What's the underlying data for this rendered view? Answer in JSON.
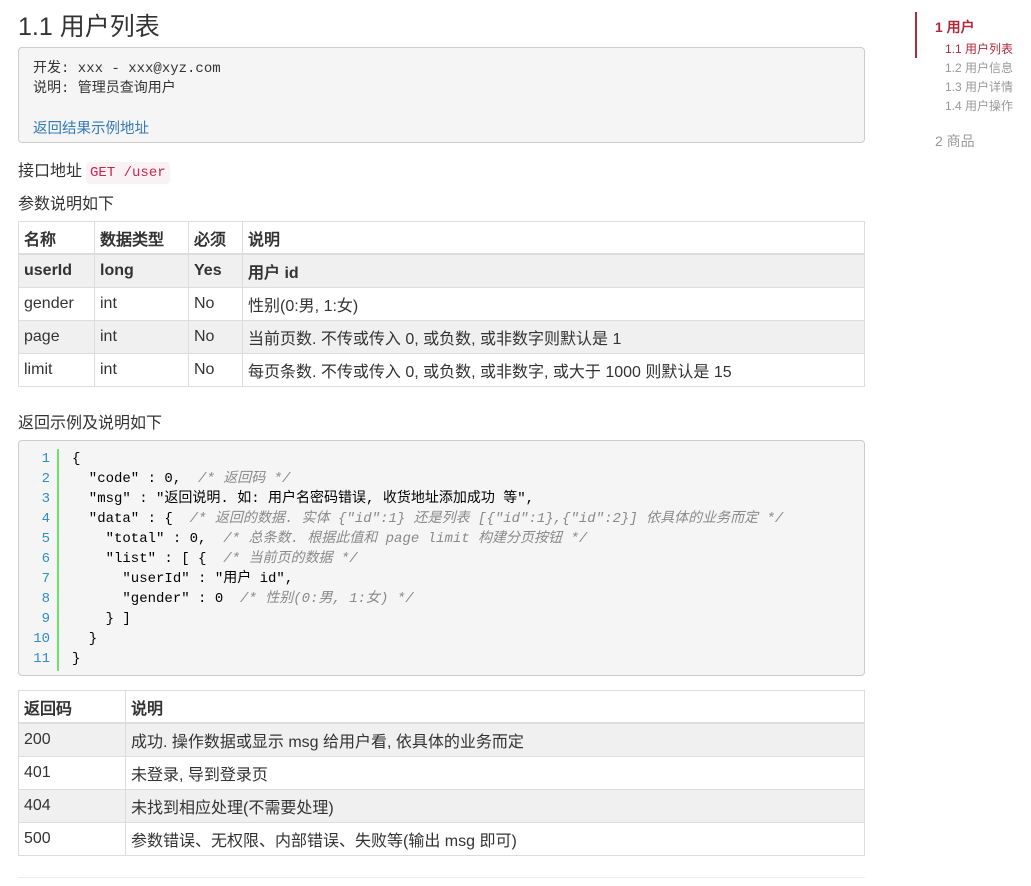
{
  "page": {
    "title": "1.1 用户列表",
    "info": {
      "developer_line": "开发: xxx - xxx@xyz.com",
      "description_line": "说明: 管理员查询用户",
      "example_link": "返回结果示例地址"
    },
    "api": {
      "label": "接口地址",
      "value": "GET /user"
    },
    "params_heading": "参数说明如下",
    "params_table": {
      "headers": [
        "名称",
        "数据类型",
        "必须",
        "说明"
      ],
      "rows": [
        [
          "userId",
          "long",
          "Yes",
          "用户 id"
        ],
        [
          "gender",
          "int",
          "No",
          "性别(0:男, 1:女)"
        ],
        [
          "page",
          "int",
          "No",
          "当前页数. 不传或传入 0, 或负数, 或非数字则默认是 1"
        ],
        [
          "limit",
          "int",
          "No",
          "每页条数. 不传或传入 0, 或负数, 或非数字, 或大于 1000 则默认是 15"
        ]
      ]
    },
    "return_heading": "返回示例及说明如下",
    "code_sample": {
      "line_numbers": [
        "1",
        "2",
        "3",
        "4",
        "5",
        "6",
        "7",
        "8",
        "9",
        "10",
        "11"
      ],
      "lines": [
        {
          "code": "{",
          "comment": ""
        },
        {
          "code": "  \"code\" : 0,  ",
          "comment": "/* 返回码 */"
        },
        {
          "code": "  \"msg\" : \"返回说明. 如: 用户名密码错误, 收货地址添加成功 等\",",
          "comment": ""
        },
        {
          "code": "  \"data\" : {  ",
          "comment": "/* 返回的数据. 实体 {\"id\":1} 还是列表 [{\"id\":1},{\"id\":2}] 依具体的业务而定 */"
        },
        {
          "code": "    \"total\" : 0,  ",
          "comment": "/* 总条数. 根据此值和 page limit 构建分页按钮 */"
        },
        {
          "code": "    \"list\" : [ {  ",
          "comment": "/* 当前页的数据 */"
        },
        {
          "code": "      \"userId\" : \"用户 id\",",
          "comment": ""
        },
        {
          "code": "      \"gender\" : 0  ",
          "comment": "/* 性别(0:男, 1:女) */"
        },
        {
          "code": "    } ]",
          "comment": ""
        },
        {
          "code": "  }",
          "comment": ""
        },
        {
          "code": "}",
          "comment": ""
        }
      ]
    },
    "codes_table": {
      "headers": [
        "返回码",
        "说明"
      ],
      "rows": [
        [
          "200",
          "成功. 操作数据或显示 msg 给用户看, 依具体的业务而定"
        ],
        [
          "401",
          "未登录, 导到登录页"
        ],
        [
          "404",
          "未找到相应处理(不需要处理)"
        ],
        [
          "500",
          "参数错误、无权限、内部错误、失败等(输出 msg 即可)"
        ]
      ]
    }
  },
  "toc": {
    "items": [
      {
        "label": "1 用户",
        "level": 1,
        "active": true
      },
      {
        "label": "1.1 用户列表",
        "level": 2,
        "active": true
      },
      {
        "label": "1.2 用户信息",
        "level": 2,
        "active": false
      },
      {
        "label": "1.3 用户详情",
        "level": 2,
        "active": false
      },
      {
        "label": "1.4 用户操作",
        "level": 2,
        "active": false
      },
      {
        "label": "2 商品",
        "level": 1,
        "active": false
      }
    ]
  },
  "colors": {
    "accent": "#b0293b",
    "link": "#337ab7",
    "inline_code": "#c7254e",
    "line_number": "#2f8fc3",
    "gutter_rule": "#6ce26c"
  }
}
